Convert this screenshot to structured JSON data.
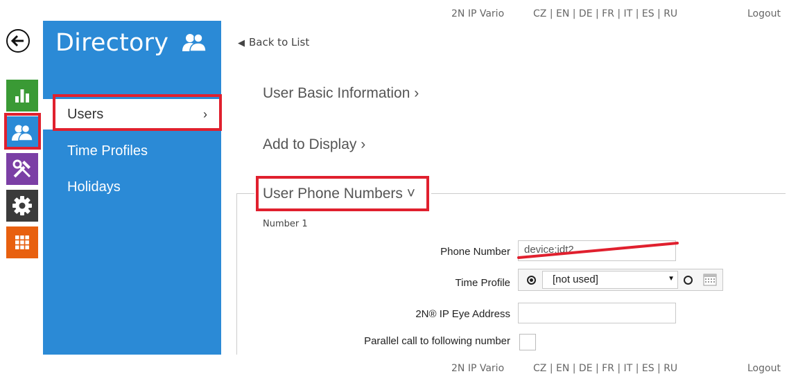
{
  "header": {
    "product": "2N IP Vario",
    "languages": "CZ | EN | DE | FR | IT | ES | RU",
    "logout": "Logout"
  },
  "footer": {
    "product": "2N IP Vario",
    "languages": "CZ | EN | DE | FR | IT | ES | RU",
    "logout": "Logout"
  },
  "rail": {
    "icons": [
      "back-arrow",
      "status-chart",
      "directory-users",
      "services-tools",
      "system-gear",
      "hardware-grid"
    ],
    "colors": {
      "status": "#3a9a35",
      "directory": "#2b8ad6",
      "services": "#7b3fa5",
      "system": "#3b3b3b",
      "hardware": "#e8600f"
    }
  },
  "sidebar": {
    "title": "Directory",
    "items": [
      {
        "label": "Users",
        "chevron": "›"
      },
      {
        "label": "Time Profiles"
      },
      {
        "label": "Holidays"
      }
    ]
  },
  "main": {
    "back_link": "Back to List",
    "sections": [
      {
        "label": "User Basic Information ›"
      },
      {
        "label": "Add to Display ›"
      },
      {
        "label": "User Phone Numbers ˅"
      }
    ],
    "number_title": "Number 1",
    "fields": {
      "phone_number_label": "Phone Number",
      "phone_number_value": "device:idt2",
      "time_profile_label": "Time Profile",
      "time_profile_value": "[not used]",
      "eye_address_label": "2N® IP Eye Address",
      "eye_address_value": "",
      "parallel_label": "Parallel call to following number"
    }
  },
  "highlight_color": "#e0202e"
}
